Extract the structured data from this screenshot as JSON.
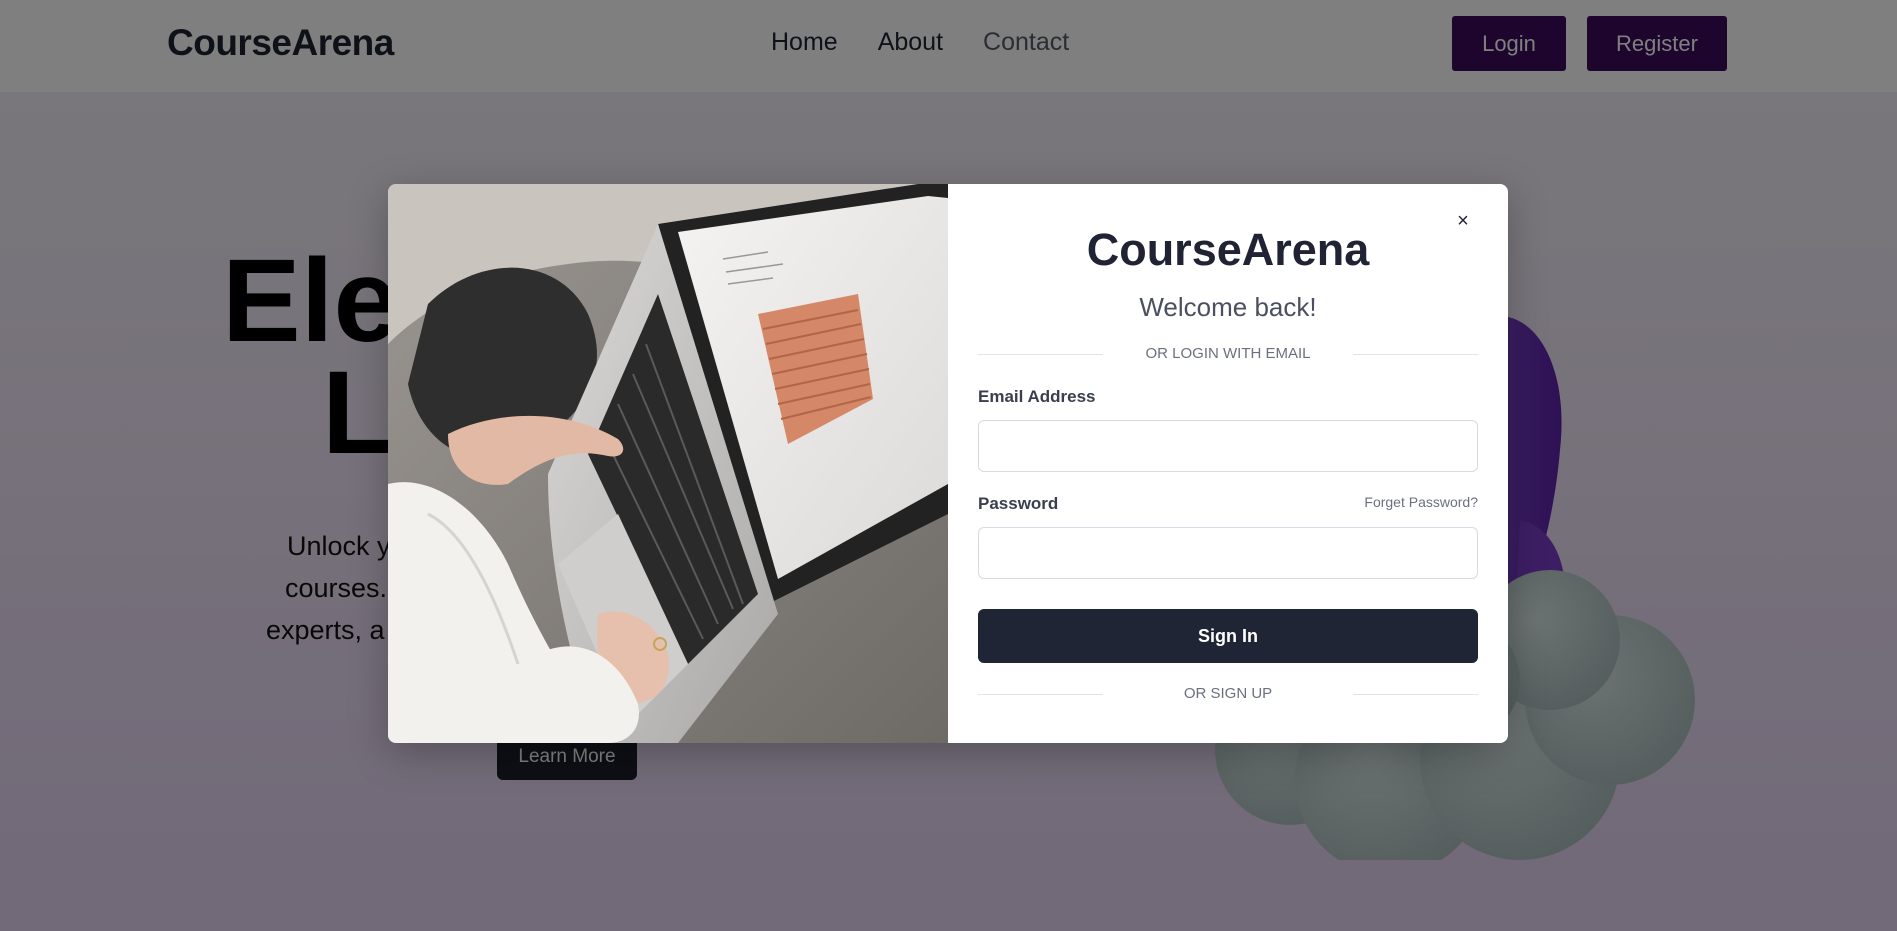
{
  "navbar": {
    "brand": "CourseArena",
    "links": [
      "Home",
      "About",
      "Contact"
    ],
    "login_label": "Login",
    "register_label": "Register"
  },
  "hero": {
    "title_line1": "Ele",
    "title_line2": "L",
    "subtitle_lines": [
      "Unlock y",
      "courses.",
      "experts, a"
    ],
    "learn_more_label": "Learn More"
  },
  "modal": {
    "close_label": "×",
    "brand": "CourseArena",
    "welcome": "Welcome back!",
    "login_divider": "OR LOGIN WITH EMAIL",
    "email_label": "Email Address",
    "email_value": "",
    "password_label": "Password",
    "password_value": "",
    "forgot_label": "Forget Password?",
    "signin_label": "Sign In",
    "signup_divider": "OR SIGN UP"
  },
  "colors": {
    "brand_purple": "#3b0a5c",
    "dark_button": "#1f2535",
    "overlay": "rgba(0,0,0,0.5)"
  },
  "icons": {
    "close": "close-icon"
  }
}
